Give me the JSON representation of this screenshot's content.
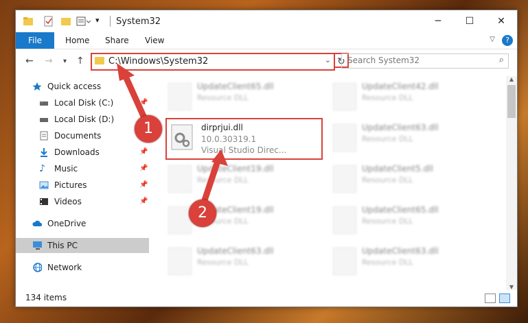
{
  "window": {
    "title": "System32"
  },
  "window_controls": {
    "minimize": "─",
    "maximize": "☐",
    "close": "✕"
  },
  "ribbon": {
    "tabs": [
      "File",
      "Home",
      "Share",
      "View"
    ],
    "help": "?"
  },
  "address": {
    "path": "C:\\Windows\\System32"
  },
  "search": {
    "placeholder": "Search System32"
  },
  "sidebar": {
    "items": [
      {
        "label": "Quick access",
        "icon": "star-icon",
        "color": "#1979ca"
      },
      {
        "label": "Local Disk (C:)",
        "icon": "drive-icon",
        "color": "#555555"
      },
      {
        "label": "Local Disk (D:)",
        "icon": "drive-icon",
        "color": "#555555"
      },
      {
        "label": "Documents",
        "icon": "documents-icon",
        "color": "#777777"
      },
      {
        "label": "Downloads",
        "icon": "download-icon",
        "color": "#1979ca"
      },
      {
        "label": "Music",
        "icon": "music-icon",
        "color": "#1979ca"
      },
      {
        "label": "Pictures",
        "icon": "pictures-icon",
        "color": "#3a8ed8"
      },
      {
        "label": "Videos",
        "icon": "videos-icon",
        "color": "#333333"
      },
      {
        "label": "OneDrive",
        "icon": "cloud-icon",
        "color": "#1979ca"
      },
      {
        "label": "This PC",
        "icon": "computer-icon",
        "color": "#3a8ed8"
      },
      {
        "label": "Network",
        "icon": "network-icon",
        "color": "#1979ca"
      }
    ]
  },
  "files": [
    {
      "name": "UpdateClient65.dll",
      "desc": "Resource DLL"
    },
    {
      "name": "UpdateClient42.dll",
      "desc": "Resource DLL"
    },
    {
      "name": "UpdateClient63.dll",
      "desc": "Resource DLL"
    },
    {
      "name": "UpdateClient19.dll",
      "desc": "Resource DLL"
    },
    {
      "name": "UpdateClient5.dll",
      "desc": "Resource DLL"
    },
    {
      "name": "UpdateClient19.dll",
      "desc": "Resource DLL"
    },
    {
      "name": "UpdateClient65.dll",
      "desc": "Resource DLL"
    },
    {
      "name": "UpdateClient63.dll",
      "desc": "Resource DLL"
    },
    {
      "name": "UpdateClient63.dll",
      "desc": "Resource DLL"
    }
  ],
  "highlighted_file": {
    "name": "dirprjui.dll",
    "version": "10.0.30319.1",
    "desc": "Visual Studio Direc..."
  },
  "status": {
    "item_count": "134 items"
  },
  "callouts": {
    "step1": "1",
    "step2": "2"
  },
  "colors": {
    "accent": "#1979ca",
    "callout": "#d9413a"
  }
}
